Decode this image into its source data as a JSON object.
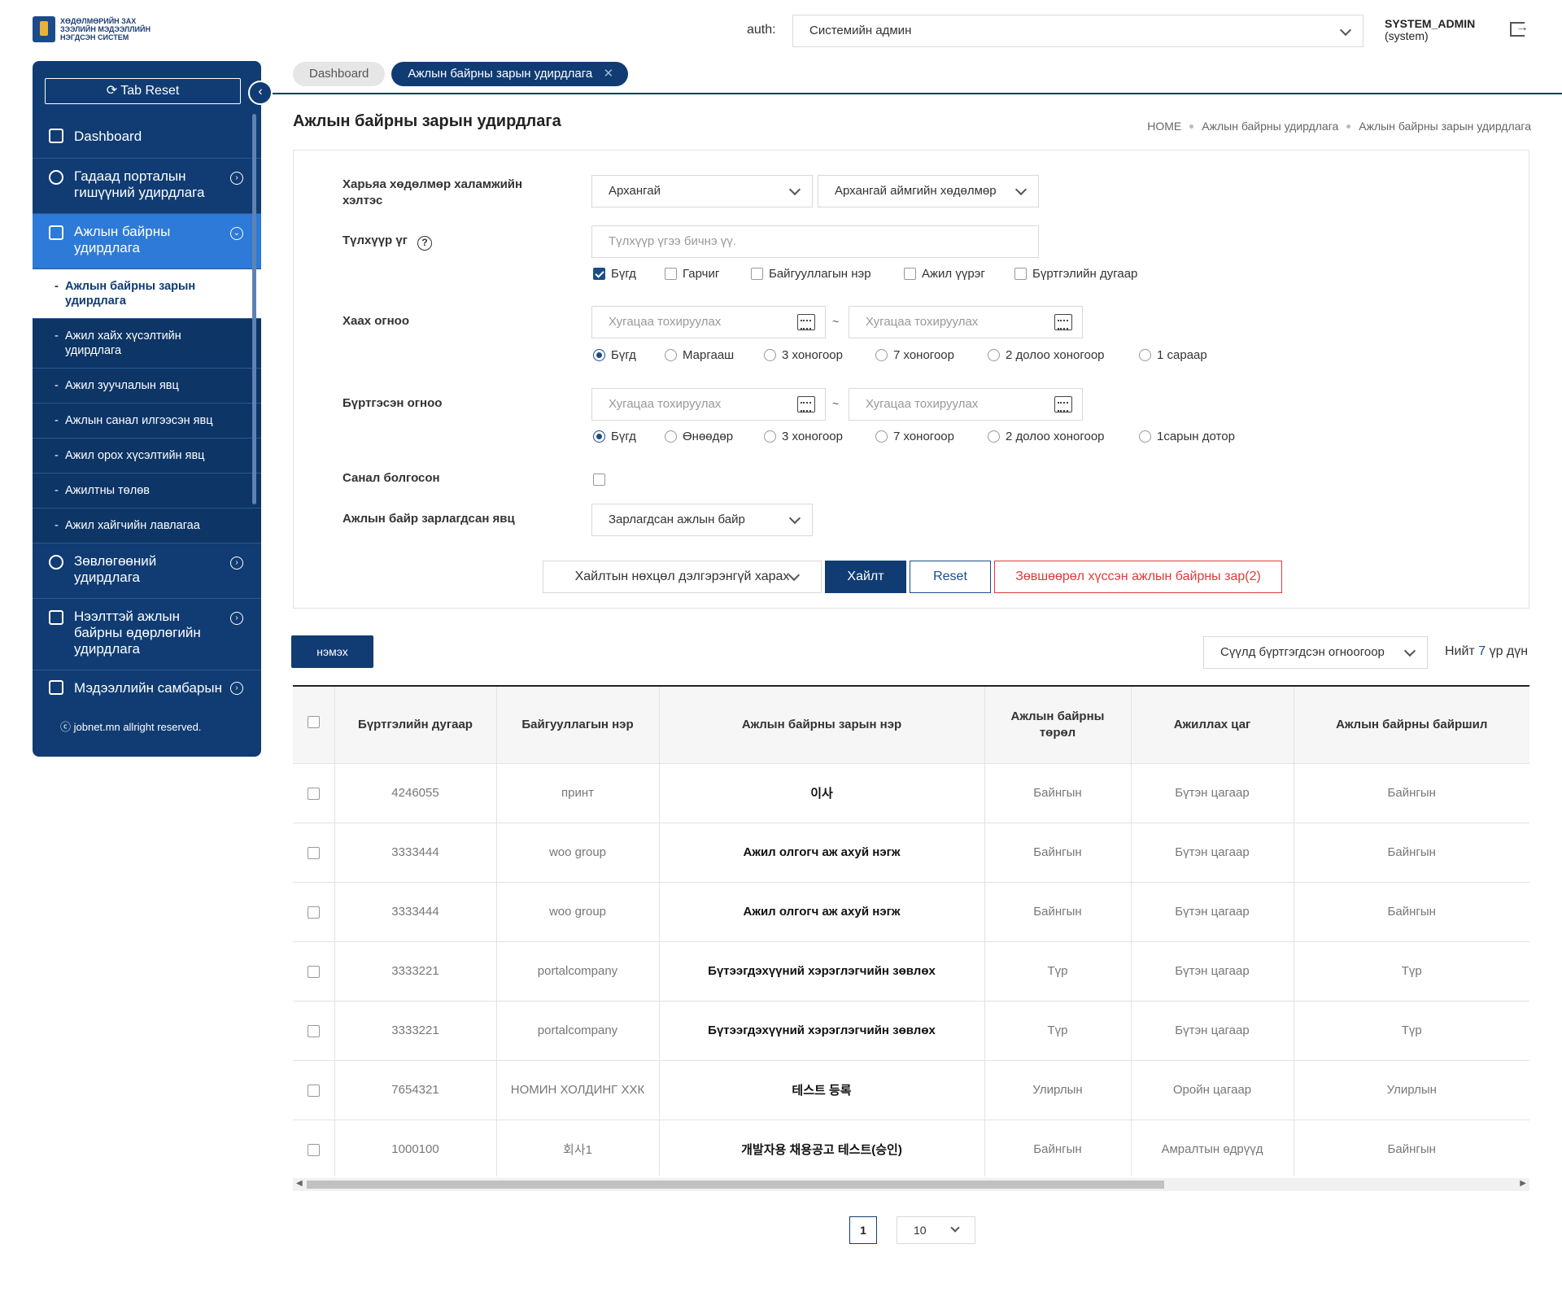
{
  "header": {
    "logo_text": "ХӨДӨЛМӨРИЙН ЗАХ ЗЭЭЛИЙН МЭДЭЭЛЛИЙН НЭГДСЭН СИСТЕМ",
    "auth_label": "auth:",
    "auth_value": "Системийн админ",
    "user_role": "SYSTEM_ADMIN",
    "user_name": "(system)"
  },
  "sidebar": {
    "tab_reset": "Tab Reset",
    "menu": {
      "dashboard": "Dashboard",
      "portal": "Гадаад порталын гишүүний удирдлага",
      "jobs": "Ажлын байрны удирдлага",
      "advice": "Зөвлөгөөний удирдлага",
      "open_jobs": "Нээлттэй ажлын байрны өдөрлөгийн удирдлага",
      "info": "Мэдээллийн самбарын"
    },
    "sub_items": [
      "Ажлын байрны зарын удирдлага",
      "Ажил хайх хүсэлтийн удирдлага",
      "Ажил зуучлалын явц",
      "Ажлын санал илгээсэн явц",
      "Ажил орох хүсэлтийн явц",
      "Ажилтны төлөв",
      "Ажил хайгчийн лавлагаа"
    ],
    "copyright": "ⓒ jobnet.mn allright reserved."
  },
  "tabs": {
    "dashboard": "Dashboard",
    "current": "Ажлын байрны зарын удирдлага"
  },
  "page": {
    "title": "Ажлын байрны зарын удирдлага",
    "breadcrumb": [
      "HOME",
      "Ажлын байрны удирдлага",
      "Ажлын байрны зарын удирдлага"
    ]
  },
  "form": {
    "dept_label": "Харьяа хөдөлмөр халамжийн хэлтэс",
    "dept_select1": "Архангай",
    "dept_select2": "Архангай аймгийн хөдөлмөр",
    "keyword_label": "Түлхүүр үг",
    "keyword_placeholder": "Түлхүүр үгээ бичнэ үү.",
    "keyword_options": [
      "Бүгд",
      "Гарчиг",
      "Байгууллагын нэр",
      "Ажил үүрэг",
      "Бүртгэлийн дугаар"
    ],
    "close_label": "Хаах огноо",
    "date_placeholder": "Хугацаа тохируулах",
    "tilde": "~",
    "close_options": [
      "Бүгд",
      "Маргааш",
      "3 хоногоор",
      "7 хоногоор",
      "2 долоо хоногоор",
      "1 сараар"
    ],
    "reg_label": "Бүртгэсэн огноо",
    "reg_options": [
      "Бүгд",
      "Өнөөдөр",
      "3 хоногоор",
      "7 хоногоор",
      "2 долоо хоногоор",
      "1сарын дотор"
    ],
    "offer_label": "Санал болгосон",
    "status_label": "Ажлын байр зарлагдсан явц",
    "status_value": "Зарлагдсан ажлын байр",
    "adv_button": "Хайлтын нөхцөл дэлгэрэнгүй харах",
    "search_button": "Хайлт",
    "reset_button": "Reset",
    "request_button": "Зөвшөөрөл хүссэн ажлын байрны зар(2)"
  },
  "toolbar": {
    "add_button": "нэмэх",
    "sort_value": "Сүүлд бүртгэгдсэн огноогоор",
    "total_prefix": "Нийт",
    "total_count": "7",
    "total_suffix": "үр дүн"
  },
  "table": {
    "headers": [
      "Бүртгэлийн дугаар",
      "Байгууллагын нэр",
      "Ажлын байрны зарын нэр",
      "Ажлын байрны төрөл",
      "Ажиллах цаг",
      "Ажлын байрны байршил"
    ],
    "rows": [
      [
        "4246055",
        "принт",
        "이사",
        "Байнгын",
        "Бүтэн цагаар",
        "Байнгын"
      ],
      [
        "3333444",
        "woo group",
        "Ажил олгогч аж ахуй нэгж",
        "Байнгын",
        "Бүтэн цагаар",
        "Байнгын"
      ],
      [
        "3333444",
        "woo group",
        "Ажил олгогч аж ахуй нэгж",
        "Байнгын",
        "Бүтэн цагаар",
        "Байнгын"
      ],
      [
        "3333221",
        "portalcompany",
        "Бүтээгдэхүүний хэрэглэгчийн зөвлөх",
        "Түр",
        "Бүтэн цагаар",
        "Түр"
      ],
      [
        "3333221",
        "portalcompany",
        "Бүтээгдэхүүний хэрэглэгчийн зөвлөх",
        "Түр",
        "Бүтэн цагаар",
        "Түр"
      ],
      [
        "7654321",
        "НОМИН ХОЛДИНГ ХХК",
        "테스트 등록",
        "Улирлын",
        "Оройн цагаар",
        "Улирлын"
      ],
      [
        "1000100",
        "회사1",
        "개발자용 채용공고 테스트(승인)",
        "Байнгын",
        "Амралтын өдрүүд",
        "Байнгын"
      ]
    ]
  },
  "pagination": {
    "current": "1",
    "page_size": "10"
  }
}
